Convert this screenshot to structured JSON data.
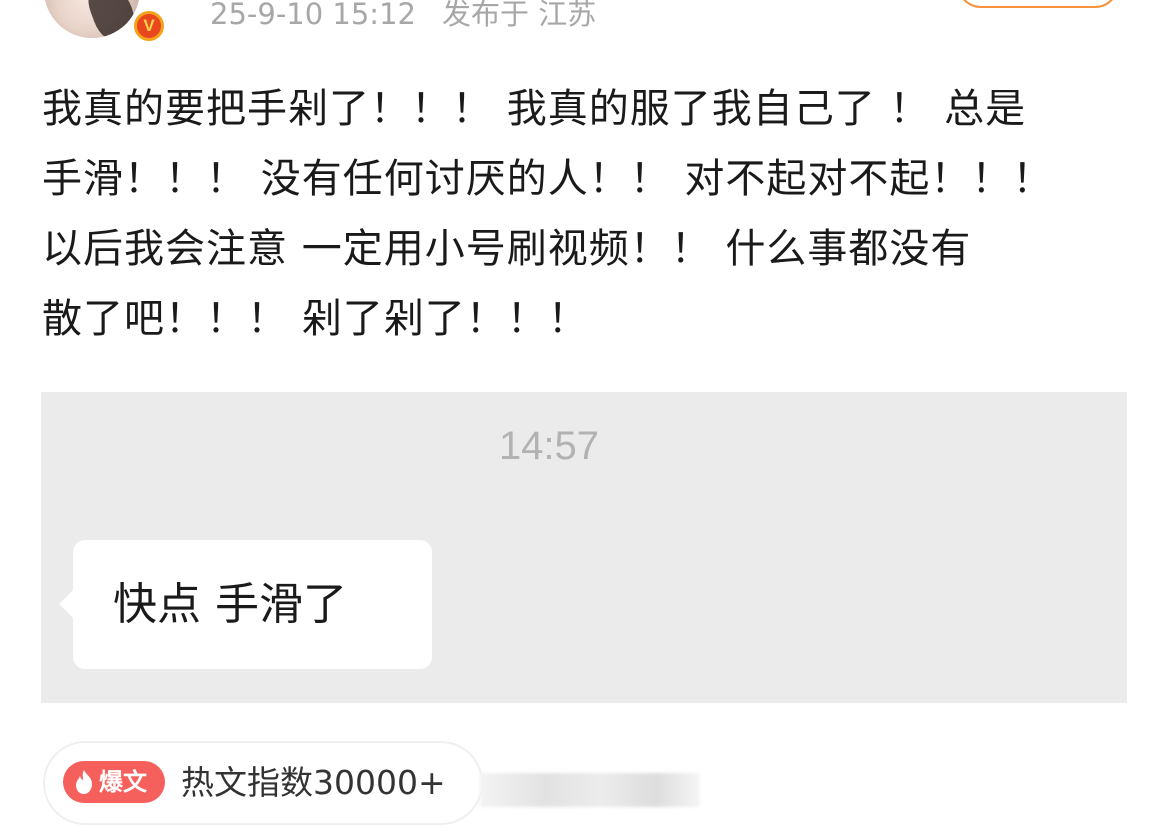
{
  "header": {
    "timestamp": "25-9-10 15:12",
    "location": "发布于 江苏",
    "verified_mark": "V"
  },
  "post": {
    "lines": [
      "我真的要把手剁了！！！ 我真的服了我自己了 ！ 总是",
      "手滑！！！ 没有任何讨厌的人！！ 对不起对不起！！！",
      "以后我会注意 一定用小号刷视频！！ 什么事都没有",
      "散了吧！！！ 剁了剁了！！！"
    ]
  },
  "chat_image": {
    "time": "14:57",
    "message": "快点 手滑了"
  },
  "hot": {
    "tag_label": "爆文",
    "index_text": "热文指数30000+"
  },
  "colors": {
    "meta_gray": "#a7a7a7",
    "follow_orange": "#f7913c",
    "hot_red": "#f5605c",
    "chat_bg": "#ebebeb"
  }
}
